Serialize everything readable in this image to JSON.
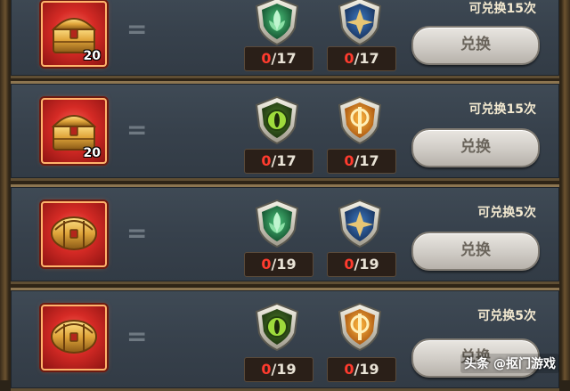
{
  "rows": [
    {
      "chest_count": "20",
      "equals": "=",
      "badge_left": "green-leaf-shield-icon",
      "badge_right": "blue-star-shield-icon",
      "counter_left": {
        "current": "0",
        "sep": "/",
        "max": "17"
      },
      "counter_right": {
        "current": "0",
        "sep": "/",
        "max": "17"
      },
      "limit": "可兑换15次",
      "button": "兑换"
    },
    {
      "chest_count": "20",
      "equals": "=",
      "badge_left": "green-eye-shield-icon",
      "badge_right": "orange-sun-shield-icon",
      "counter_left": {
        "current": "0",
        "sep": "/",
        "max": "17"
      },
      "counter_right": {
        "current": "0",
        "sep": "/",
        "max": "17"
      },
      "limit": "可兑换15次",
      "button": "兑换"
    },
    {
      "chest_count": "",
      "equals": "=",
      "badge_left": "green-leaf-shield-icon",
      "badge_right": "blue-star-shield-icon",
      "counter_left": {
        "current": "0",
        "sep": "/",
        "max": "19"
      },
      "counter_right": {
        "current": "0",
        "sep": "/",
        "max": "19"
      },
      "limit": "可兑换5次",
      "button": "兑换"
    },
    {
      "chest_count": "",
      "equals": "=",
      "badge_left": "green-eye-shield-icon",
      "badge_right": "orange-sun-shield-icon",
      "counter_left": {
        "current": "0",
        "sep": "/",
        "max": "19"
      },
      "counter_right": {
        "current": "0",
        "sep": "/",
        "max": "19"
      },
      "limit": "可兑换5次",
      "button": "兑换"
    }
  ],
  "watermark": "头条 @抠门游戏",
  "colors": {
    "counter_current": "#ff3b2e",
    "chest_frame": "#d52a25",
    "row_bg": "#37414c",
    "row_border": "#8c7550"
  }
}
